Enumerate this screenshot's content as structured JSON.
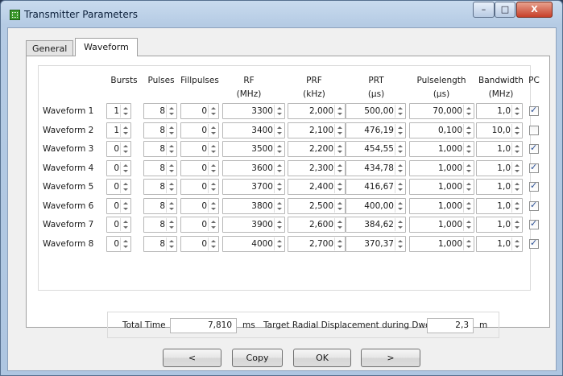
{
  "window": {
    "title": "Transmitter Parameters",
    "min_glyph": "–",
    "max_glyph": "□",
    "close_glyph": "X"
  },
  "tabs": [
    "General",
    "Waveform"
  ],
  "headers": {
    "bursts": "Bursts",
    "pulses": "Pulses",
    "fillpulses": "Fillpulses",
    "rf": [
      "RF",
      "(MHz)"
    ],
    "prf": [
      "PRF",
      "(kHz)"
    ],
    "prt": [
      "PRT",
      "(µs)"
    ],
    "pulselength": [
      "Pulselength",
      "(µs)"
    ],
    "bandwidth": [
      "Bandwidth",
      "(MHz)"
    ],
    "pc": "PC"
  },
  "waveforms": [
    {
      "label": "Waveform 1",
      "bursts": "1",
      "pulses": "8",
      "fillpulses": "0",
      "rf": "3300",
      "prf": "2,000",
      "prt": "500,00",
      "pulselength": "70,000",
      "bandwidth": "1,0",
      "pc": true
    },
    {
      "label": "Waveform 2",
      "bursts": "1",
      "pulses": "8",
      "fillpulses": "0",
      "rf": "3400",
      "prf": "2,100",
      "prt": "476,19",
      "pulselength": "0,100",
      "bandwidth": "10,0",
      "pc": false
    },
    {
      "label": "Waveform 3",
      "bursts": "0",
      "pulses": "8",
      "fillpulses": "0",
      "rf": "3500",
      "prf": "2,200",
      "prt": "454,55",
      "pulselength": "1,000",
      "bandwidth": "1,0",
      "pc": true
    },
    {
      "label": "Waveform 4",
      "bursts": "0",
      "pulses": "8",
      "fillpulses": "0",
      "rf": "3600",
      "prf": "2,300",
      "prt": "434,78",
      "pulselength": "1,000",
      "bandwidth": "1,0",
      "pc": true
    },
    {
      "label": "Waveform 5",
      "bursts": "0",
      "pulses": "8",
      "fillpulses": "0",
      "rf": "3700",
      "prf": "2,400",
      "prt": "416,67",
      "pulselength": "1,000",
      "bandwidth": "1,0",
      "pc": true
    },
    {
      "label": "Waveform 6",
      "bursts": "0",
      "pulses": "8",
      "fillpulses": "0",
      "rf": "3800",
      "prf": "2,500",
      "prt": "400,00",
      "pulselength": "1,000",
      "bandwidth": "1,0",
      "pc": true
    },
    {
      "label": "Waveform 7",
      "bursts": "0",
      "pulses": "8",
      "fillpulses": "0",
      "rf": "3900",
      "prf": "2,600",
      "prt": "384,62",
      "pulselength": "1,000",
      "bandwidth": "1,0",
      "pc": true
    },
    {
      "label": "Waveform 8",
      "bursts": "0",
      "pulses": "8",
      "fillpulses": "0",
      "rf": "4000",
      "prf": "2,700",
      "prt": "370,37",
      "pulselength": "1,000",
      "bandwidth": "1,0",
      "pc": true
    }
  ],
  "summary": {
    "total_time_label": "Total Time",
    "total_time_value": "7,810",
    "total_time_unit": "ms",
    "displacement_label": "Target Radial Displacement during Dwell",
    "displacement_value": "2,3",
    "displacement_unit": "m"
  },
  "buttons": {
    "prev": "<",
    "copy": "Copy",
    "ok": "OK",
    "next": ">"
  }
}
